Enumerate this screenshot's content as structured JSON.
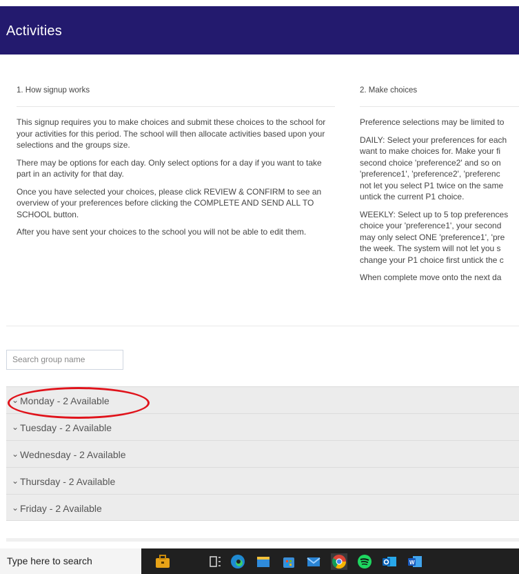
{
  "header": {
    "title": "Activities"
  },
  "how_signup": {
    "heading": "1. How signup works",
    "paragraphs": [
      "This signup requires you to make choices and submit these choices to the school for your activities for this period. The school will then allocate activities based upon your selections and the groups size.",
      "There may be options for each day. Only select options for a day if you want to take part in an activity for that day.",
      "Once you have selected your choices, please click REVIEW & CONFIRM to see an overview of your preferences before clicking the COMPLETE AND SEND ALL TO SCHOOL button.",
      "After you have sent your choices to the school you will not be able to edit them."
    ]
  },
  "make_choices": {
    "heading": "2. Make choices",
    "p1": "Preference selections may be limited to",
    "daily": [
      "DAILY: Select your preferences for each",
      "want to make choices for. Make your fi",
      "second choice 'preference2' and so on",
      "'preference1', 'preference2', 'preferenc",
      "not let you select P1 twice on the same",
      "untick the current P1 choice."
    ],
    "weekly": [
      "WEEKLY: Select up to 5 top preferences",
      "choice your 'preference1', your second",
      "may only select ONE 'preference1', 'pre",
      "the week. The system will not let you s",
      "change your P1 choice first untick the c"
    ],
    "p_last": "When complete move onto the next da"
  },
  "search": {
    "placeholder": "Search group name"
  },
  "days": [
    {
      "label": "Monday - 2 Available"
    },
    {
      "label": "Tuesday - 2 Available"
    },
    {
      "label": "Wednesday - 2 Available"
    },
    {
      "label": "Thursday - 2 Available"
    },
    {
      "label": "Friday - 2 Available"
    }
  ],
  "taskbar": {
    "search_text": "Type here to search",
    "icons": [
      "briefcase-icon",
      "task-view-icon",
      "edge-icon",
      "file-explorer-icon",
      "store-icon",
      "mail-icon",
      "chrome-icon",
      "spotify-icon",
      "outlook-icon",
      "word-icon"
    ]
  },
  "colors": {
    "header_bg": "#231a6e",
    "highlight": "#e0131b"
  }
}
